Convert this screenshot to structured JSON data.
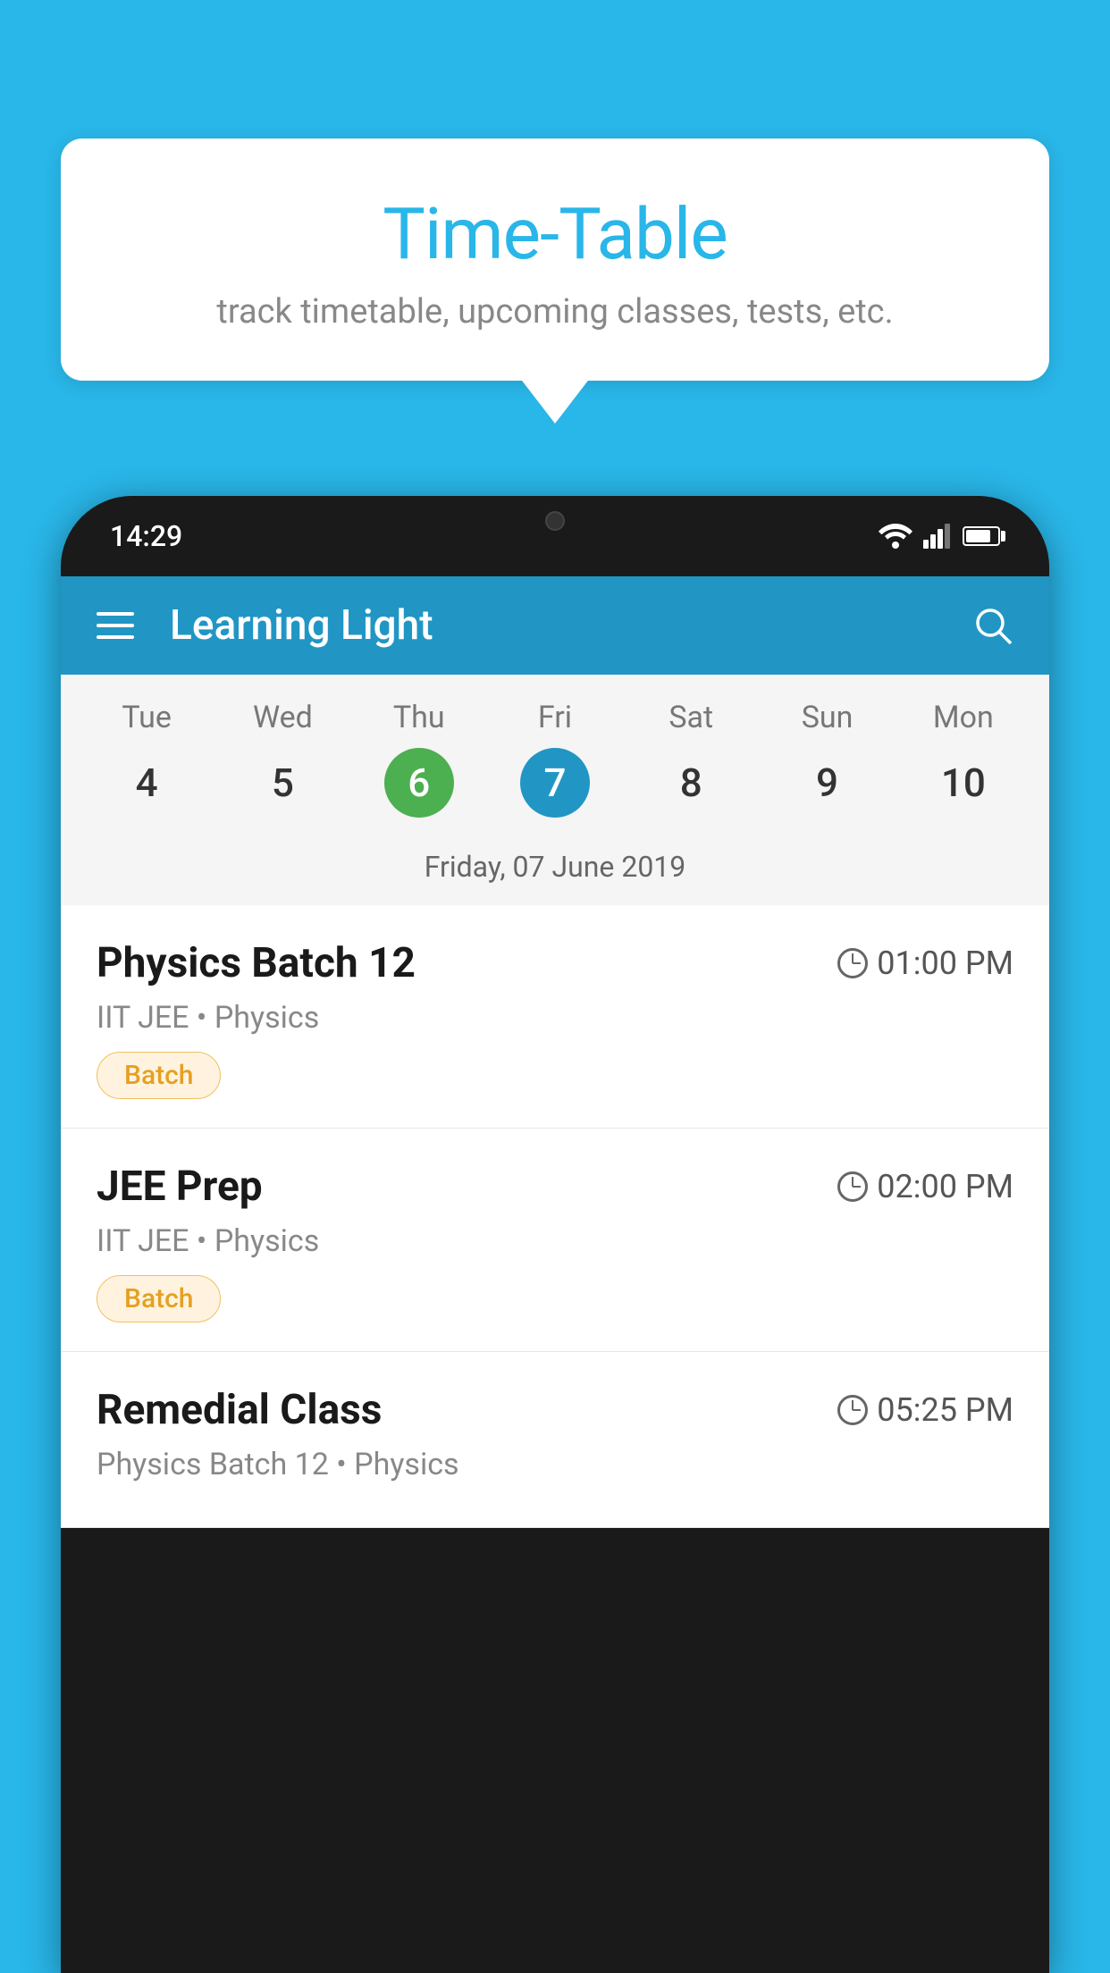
{
  "background_color": "#29b6e8",
  "tooltip": {
    "title": "Time-Table",
    "subtitle": "track timetable, upcoming classes, tests, etc."
  },
  "phone": {
    "status_bar": {
      "time": "14:29"
    },
    "app_bar": {
      "title": "Learning Light"
    },
    "calendar": {
      "days": [
        {
          "name": "Tue",
          "num": "4",
          "state": "normal"
        },
        {
          "name": "Wed",
          "num": "5",
          "state": "normal"
        },
        {
          "name": "Thu",
          "num": "6",
          "state": "today"
        },
        {
          "name": "Fri",
          "num": "7",
          "state": "selected"
        },
        {
          "name": "Sat",
          "num": "8",
          "state": "normal"
        },
        {
          "name": "Sun",
          "num": "9",
          "state": "normal"
        },
        {
          "name": "Mon",
          "num": "10",
          "state": "normal"
        }
      ],
      "selected_date_label": "Friday, 07 June 2019"
    },
    "schedule": [
      {
        "title": "Physics Batch 12",
        "time": "01:00 PM",
        "meta": "IIT JEE • Physics",
        "badge": "Batch"
      },
      {
        "title": "JEE Prep",
        "time": "02:00 PM",
        "meta": "IIT JEE • Physics",
        "badge": "Batch"
      },
      {
        "title": "Remedial Class",
        "time": "05:25 PM",
        "meta": "Physics Batch 12 • Physics",
        "badge": null
      }
    ]
  }
}
